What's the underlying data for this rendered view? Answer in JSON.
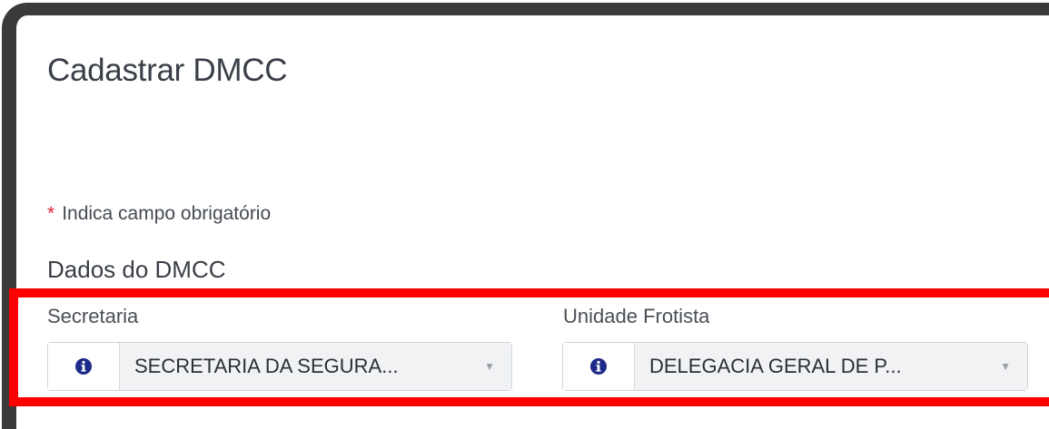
{
  "page": {
    "title": "Cadastrar DMCC"
  },
  "form": {
    "required_marker": "*",
    "required_note": "Indica campo obrigatório",
    "section_title": "Dados do DMCC",
    "fields": [
      {
        "label": "Secretaria",
        "value": "SECRETARIA DA SEGURA...",
        "icon": "info-circle-icon"
      },
      {
        "label": "Unidade Frotista",
        "value": "DELEGACIA GERAL DE P...",
        "icon": "info-circle-icon"
      }
    ]
  },
  "colors": {
    "highlight": "#ff0000",
    "required_star": "#e0243a",
    "info_icon": "#1e2a8a"
  }
}
